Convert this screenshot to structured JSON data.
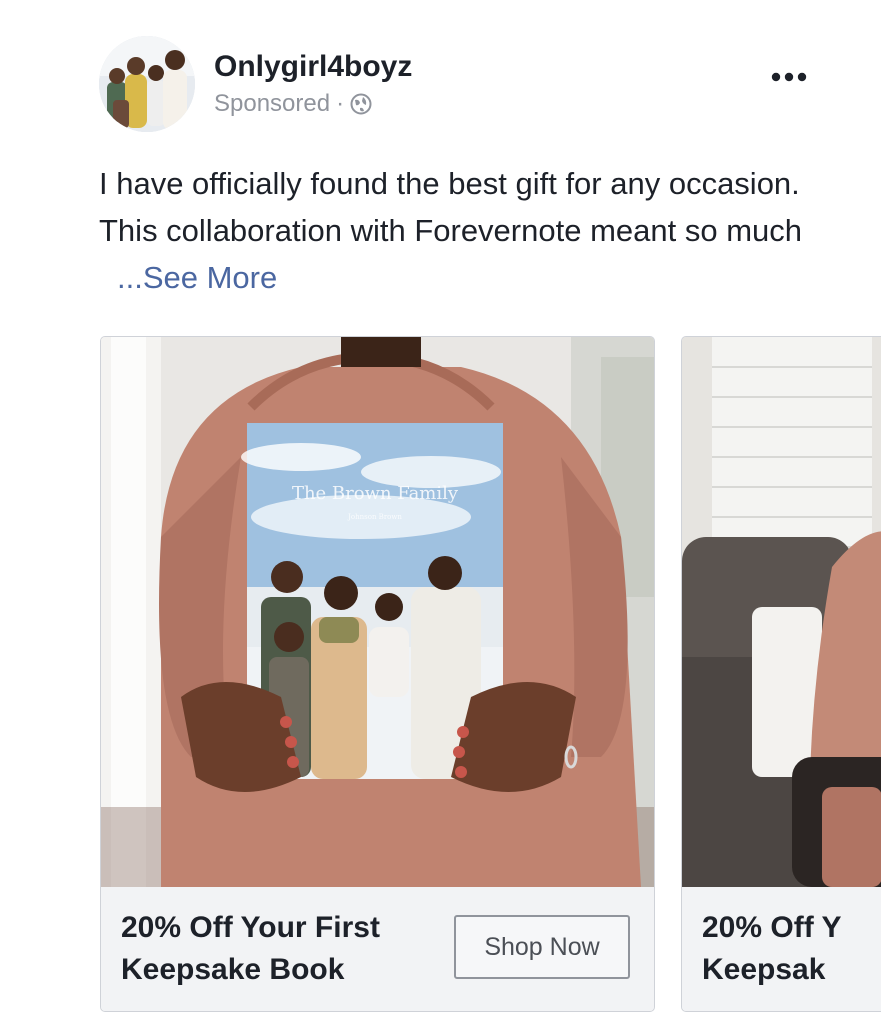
{
  "post": {
    "page_name": "Onlygirl4boyz",
    "sponsored_label": "Sponsored",
    "separator": "·",
    "privacy_icon": "globe-icon",
    "more_icon": "more-options-icon",
    "caption": "I have officially found the best gift for any occasion. This collaboration with Forevernote meant so much",
    "see_more_label": "...See More"
  },
  "carousel": {
    "cards": [
      {
        "headline": "20% Off Your First Keepsake Book",
        "headline_line1": "20% Off Your First",
        "headline_line2": "Keepsake Book",
        "cta_label": "Shop Now",
        "book_title": "The Brown Family",
        "book_subtitle": "Johnson Brown"
      },
      {
        "headline_line1": "20% Off Y",
        "headline_line2": "Keepsak"
      }
    ]
  },
  "colors": {
    "link": "#4b67a1",
    "meta_text": "#90949c",
    "body_text": "#1d2129",
    "footer_bg": "#f2f3f5"
  }
}
